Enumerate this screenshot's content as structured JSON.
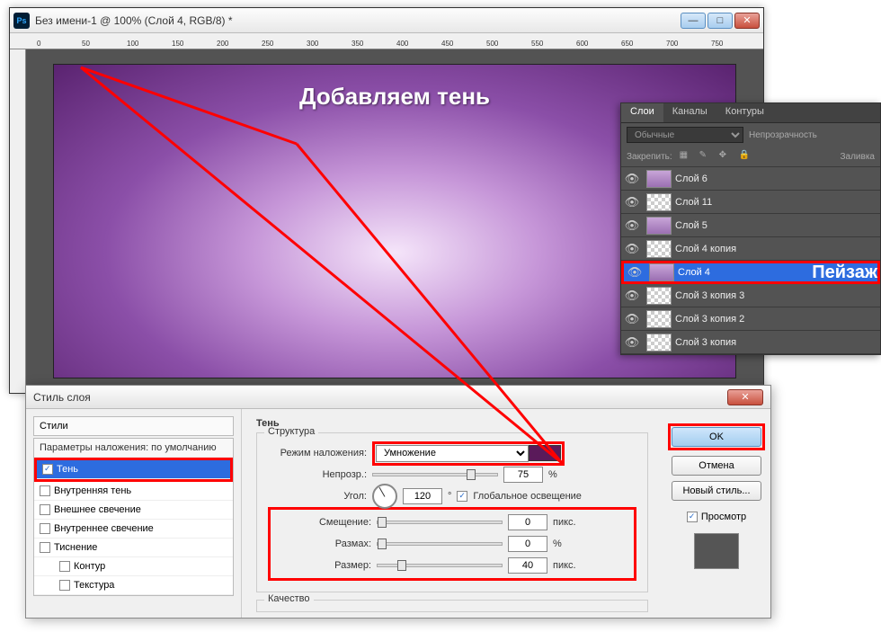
{
  "window": {
    "title": "Без имени-1 @ 100% (Слой 4, RGB/8) *",
    "ps_icon": "Ps"
  },
  "ruler_marks": [
    "0",
    "50",
    "100",
    "150",
    "200",
    "250",
    "300",
    "350",
    "400",
    "450",
    "500",
    "550",
    "600",
    "650",
    "700",
    "750"
  ],
  "annotation": {
    "title": "Добавляем тень",
    "landscape": "Пейзаж"
  },
  "layers_panel": {
    "tabs": [
      "Слои",
      "Каналы",
      "Контуры"
    ],
    "blend_mode": "Обычные",
    "opacity_label": "Непрозрачность",
    "lock_label": "Закрепить:",
    "fill_label": "Заливка",
    "layers": [
      {
        "name": "Слой 6",
        "selected": false,
        "purple": true
      },
      {
        "name": "Слой 11",
        "selected": false,
        "purple": false
      },
      {
        "name": "Слой 5",
        "selected": false,
        "purple": true
      },
      {
        "name": "Слой 4 копия",
        "selected": false,
        "purple": false
      },
      {
        "name": "Слой 4",
        "selected": true,
        "purple": true
      },
      {
        "name": "Слой 3 копия 3",
        "selected": false,
        "purple": false
      },
      {
        "name": "Слой 3 копия 2",
        "selected": false,
        "purple": false
      },
      {
        "name": "Слой 3 копия",
        "selected": false,
        "purple": false
      }
    ]
  },
  "layer_style": {
    "dialog_title": "Стиль слоя",
    "styles_header": "Стили",
    "default_params": "Параметры наложения: по умолчанию",
    "styles": [
      {
        "name": "Тень",
        "checked": true,
        "selected": true
      },
      {
        "name": "Внутренняя тень",
        "checked": false
      },
      {
        "name": "Внешнее свечение",
        "checked": false
      },
      {
        "name": "Внутреннее свечение",
        "checked": false
      },
      {
        "name": "Тиснение",
        "checked": false
      },
      {
        "name": "Контур",
        "checked": false,
        "indent": true
      },
      {
        "name": "Текстура",
        "checked": false,
        "indent": true
      }
    ],
    "section_shadow": "Тень",
    "section_structure": "Структура",
    "section_quality": "Качество",
    "blend_label": "Режим наложения:",
    "blend_value": "Умножение",
    "opacity_label": "Непрозр.:",
    "opacity_value": "75",
    "opacity_unit": "%",
    "angle_label": "Угол:",
    "angle_value": "120",
    "angle_unit": "°",
    "global_light": "Глобальное освещение",
    "distance_label": "Смещение:",
    "distance_value": "0",
    "distance_unit": "пикс.",
    "spread_label": "Размах:",
    "spread_value": "0",
    "spread_unit": "%",
    "size_label": "Размер:",
    "size_value": "40",
    "size_unit": "пикс.",
    "buttons": {
      "ok": "OK",
      "cancel": "Отмена",
      "new_style": "Новый стиль...",
      "preview": "Просмотр"
    }
  }
}
